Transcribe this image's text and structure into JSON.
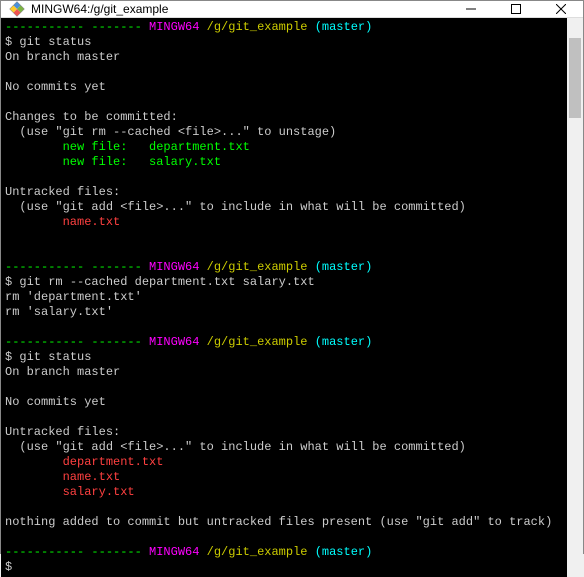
{
  "window": {
    "title": "MINGW64:/g/git_example"
  },
  "prompt": {
    "userhost_redacted": "----------- -------",
    "env": "MINGW64",
    "path": "/g/git_example",
    "branch": "(master)"
  },
  "commands": {
    "git_status": "git status",
    "git_rm": "git rm --cached department.txt salary.txt"
  },
  "out": {
    "on_branch": "On branch master",
    "no_commits": "No commits yet",
    "changes_header": "Changes to be committed:",
    "unstage_hint": "  (use \"git rm --cached <file>...\" to unstage)",
    "new_file_dept": "        new file:   department.txt",
    "new_file_salary": "        new file:   salary.txt",
    "untracked_header": "Untracked files:",
    "untracked_hint": "  (use \"git add <file>...\" to include in what will be committed)",
    "untracked_name": "        name.txt",
    "untracked_dept": "        department.txt",
    "untracked_salary": "        salary.txt",
    "rm_dept": "rm 'department.txt'",
    "rm_salary": "rm 'salary.txt'",
    "nothing_added": "nothing added to commit but untracked files present (use \"git add\" to track)"
  },
  "sym": {
    "dollar": "$",
    "space": " "
  }
}
